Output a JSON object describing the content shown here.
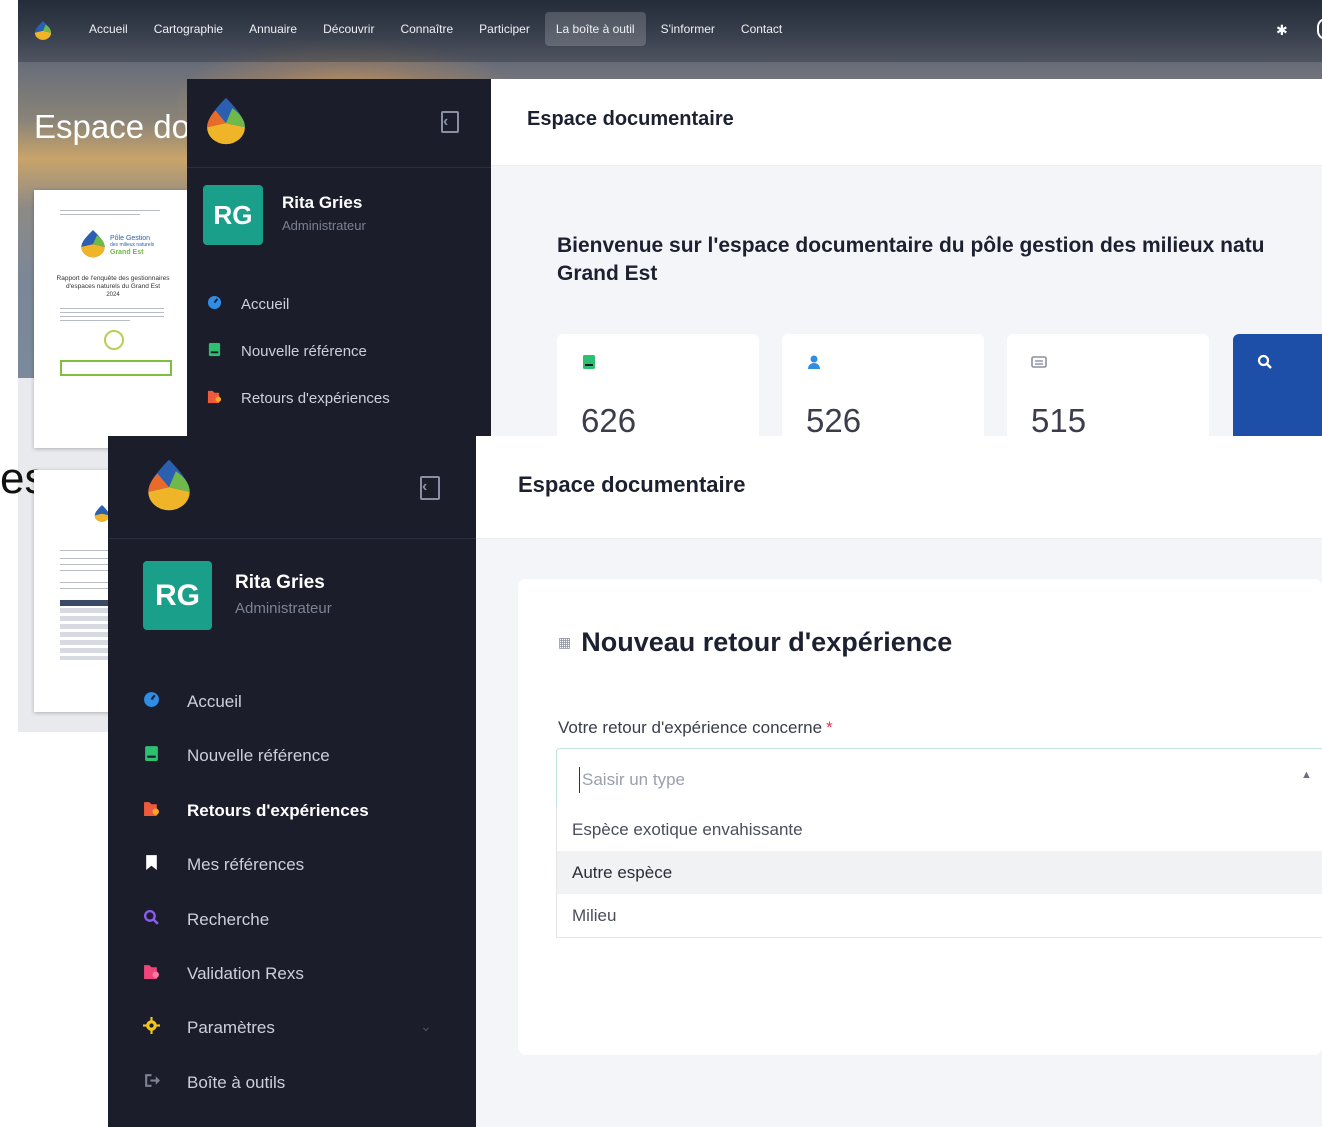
{
  "site": {
    "nav": [
      "Accueil",
      "Cartographie",
      "Annuaire",
      "Découvrir",
      "Connaître",
      "Participer",
      "La boîte à outil",
      "S'informer",
      "Contact"
    ],
    "active_nav": "La boîte à outil",
    "title": "Espace do",
    "partial_text": "es",
    "document": {
      "logo_line1": "Pôle Gestion",
      "logo_line2": "des milieux naturels",
      "logo_line3": "Grand Est",
      "title_line1": "Rapport de l'enquête des gestionnaires",
      "title_line2": "d'espaces naturels du Grand Est",
      "year": "2024"
    }
  },
  "user": {
    "initials": "RG",
    "name": "Rita Gries",
    "role": "Administrateur"
  },
  "app_title": "Espace documentaire",
  "panel_a": {
    "menu": [
      {
        "label": "Accueil",
        "icon": "dashboard-icon",
        "color": "#2f8de4"
      },
      {
        "label": "Nouvelle référence",
        "icon": "book-icon",
        "color": "#2fbf71"
      },
      {
        "label": "Retours d'expériences",
        "icon": "folder-icon",
        "color": "#f05a3c"
      }
    ],
    "welcome": "Bienvenue sur l'espace documentaire du pôle gestion des milieux natu",
    "welcome_line2": "Grand Est",
    "stats": [
      {
        "value": "626",
        "icon": "book-icon",
        "color": "#2fbf71"
      },
      {
        "value": "526",
        "icon": "user-icon",
        "color": "#2f8de4"
      },
      {
        "value": "515",
        "icon": "list-icon",
        "color": "#8a8fa3"
      }
    ]
  },
  "panel_b": {
    "menu": [
      {
        "label": "Accueil",
        "icon": "dashboard-icon",
        "color": "#2f8de4"
      },
      {
        "label": "Nouvelle référence",
        "icon": "book-icon",
        "color": "#2fbf71"
      },
      {
        "label": "Retours d'expériences",
        "icon": "folder-icon",
        "color": "#f05a3c"
      },
      {
        "label": "Mes références",
        "icon": "bookmark-icon",
        "color": "#ffffff"
      },
      {
        "label": "Recherche",
        "icon": "search-icon",
        "color": "#8b5cf6"
      },
      {
        "label": "Validation Rexs",
        "icon": "folder-check-icon",
        "color": "#f0457a"
      },
      {
        "label": "Paramètres",
        "icon": "gear-icon",
        "color": "#f5c518"
      },
      {
        "label": "Boîte à outils",
        "icon": "exit-icon",
        "color": "#7c8194"
      }
    ],
    "active_menu": "Retours d'expériences",
    "form": {
      "title": "Nouveau retour d'expérience",
      "field_label": "Votre retour d'expérience concerne",
      "required_mark": "*",
      "placeholder": "Saisir un type",
      "options": [
        "Espèce exotique envahissante",
        "Autre espèce",
        "Milieu"
      ],
      "highlighted_option": "Autre espèce"
    }
  },
  "colors": {
    "sidebar": "#1b1d2b",
    "avatar": "#1aa08a",
    "accent_blue": "#1e4fa8"
  }
}
